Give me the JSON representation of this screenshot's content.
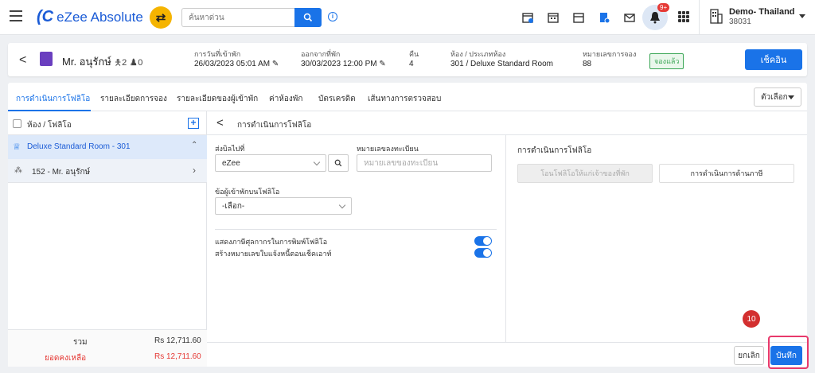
{
  "app": {
    "name": "eZee Absolute",
    "search_placeholder": "ค้นหาด่วน",
    "notif_count": "9+"
  },
  "hotel": {
    "name": "Demo- Thailand",
    "id": "38031"
  },
  "guest": {
    "name": "Mr. อนุรักษ์",
    "adults": "2",
    "children": "0",
    "arrival_label": "การวันที่เข้าพัก",
    "arrival_value": "26/03/2023 05:01 AM",
    "departure_label": "ออกจากที่พัก",
    "departure_value": "30/03/2023 12:00 PM",
    "nights_label": "คืน",
    "nights_value": "4",
    "room_label": "ห้อง / ประเภทห้อง",
    "room_value": "301 / Deluxe Standard Room",
    "booking_label": "หมายเลขการจอง",
    "booking_value": "88",
    "status": "จองแล้ว",
    "checkout_label": "เช็คอิน"
  },
  "tabs": [
    {
      "label": "การดำเนินการโฟลิโอ"
    },
    {
      "label": "รายละเอียดการจอง"
    },
    {
      "label": "รายละเอียดของผู้เข้าพัก"
    },
    {
      "label": "ค่าห้องพัก"
    },
    {
      "label": "บัตรเครดิต"
    },
    {
      "label": "เส้นทางการตรวจสอบ"
    }
  ],
  "options_label": "ตัวเลือก",
  "left_panel": {
    "header": "ห้อง / โฟลิโอ",
    "room": "Deluxe Standard Room - 301",
    "folio": "152 - Mr. อนุรักษ์",
    "total_label": "รวม",
    "total_value": "Rs 12,711.60",
    "balance_label": "ยอดคงเหลือ",
    "balance_value": "Rs 12,711.60"
  },
  "folio_ops": {
    "title": "การดำเนินการโฟลิโอ",
    "send_to_label": "ส่งบิลไปที่",
    "send_to_value": "eZee",
    "reg_label": "หมายเลขลงทะเบียน",
    "reg_placeholder": "หมายเลขของทะเบียน",
    "guest_info_label": "ข้อผู้เข้าพักบนโฟลิโอ",
    "guest_info_value": "-เลือก-",
    "toggle1_label": "แสดงภาษีศุลกากรในการพิมพ์โฟลิโอ",
    "toggle2_label": "สร้างหมายเลขใบแจ้งหนี้ตอนเช็คเอาท์"
  },
  "right_panel": {
    "title": "การดำเนินการโฟลิโอ",
    "btn1": "โอนโฟลิโอให้แก่เจ้าของที่พัก",
    "btn2": "การดำเนินการด้านภาษี"
  },
  "footer": {
    "cancel": "ยกเลิก",
    "save": "บันทึก"
  },
  "step_number": "10"
}
